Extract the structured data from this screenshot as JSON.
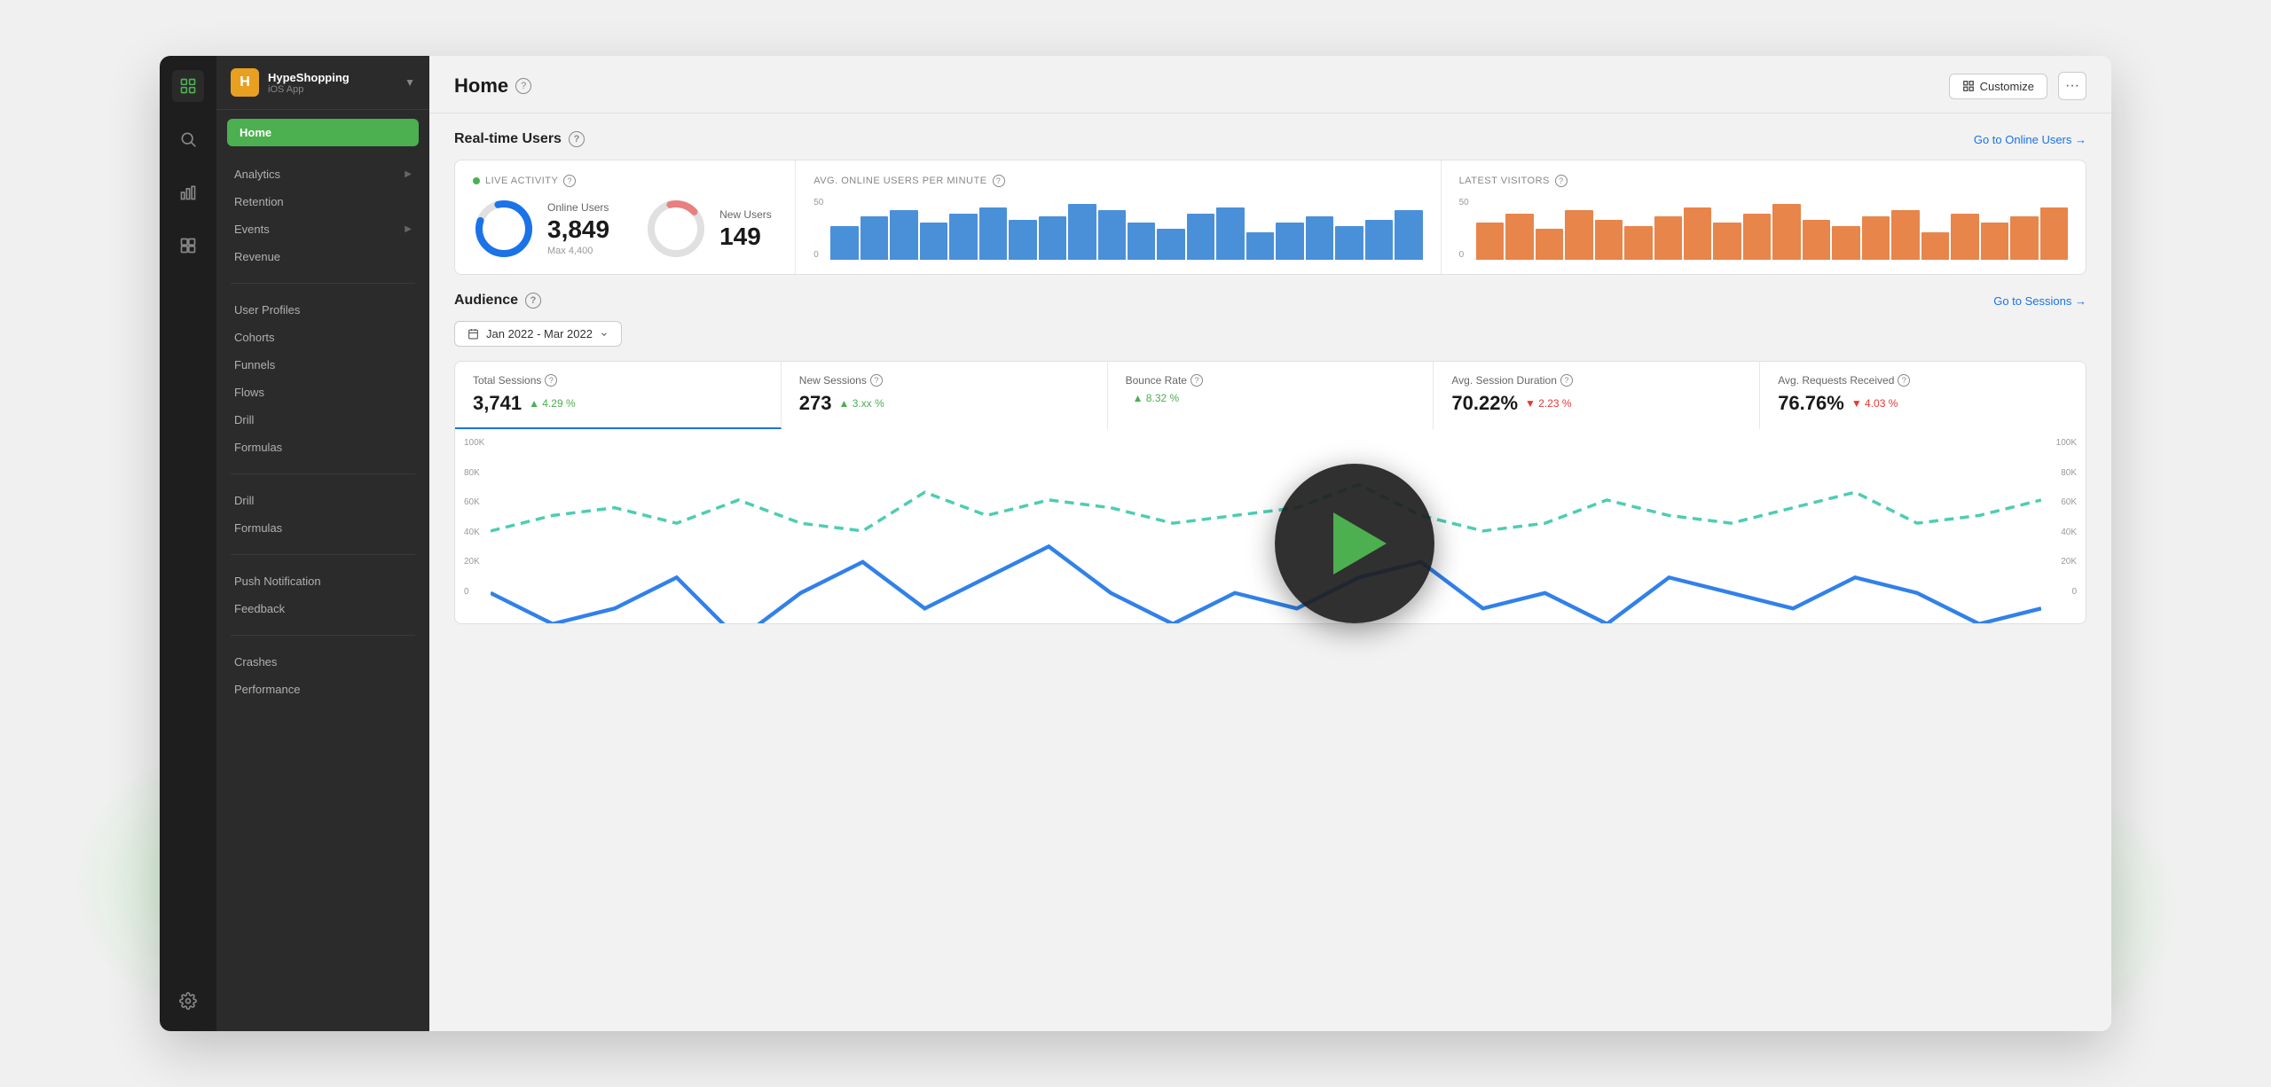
{
  "app": {
    "name": "HypeShopping",
    "type": "iOS App",
    "logo_letter": "H"
  },
  "nav": {
    "home_label": "Home",
    "analytics_label": "Analytics",
    "retention_label": "Retention",
    "events_label": "Events",
    "revenue_label": "Revenue",
    "user_profiles_label": "User Profiles",
    "cohorts_label": "Cohorts",
    "funnels_label": "Funnels",
    "flows_label": "Flows",
    "drill_label": "Drill",
    "formulas_label": "Formulas",
    "drill2_label": "Drill",
    "formulas2_label": "Formulas",
    "push_notification_label": "Push Notification",
    "feedback_label": "Feedback",
    "crashes_label": "Crashes",
    "performance_label": "Performance"
  },
  "page": {
    "title": "Home",
    "customize_label": "Customize",
    "more_label": "···"
  },
  "realtime": {
    "section_title": "Real-time Users",
    "goto_label": "Go to Online Users →",
    "live_activity_label": "LIVE ACTIVITY",
    "online_users_label": "Online Users",
    "online_users_count": "3,849",
    "online_users_max": "Max 4,400",
    "new_users_label": "New Users",
    "new_users_count": "149",
    "avg_label": "Avg. Online Users per Minute",
    "latest_visitors_label": "Latest Visitors",
    "y_high": "50",
    "y_low": "0",
    "y_high_right": "50",
    "y_low_right": "0"
  },
  "audience": {
    "section_title": "Audience",
    "date_range": "Jan 2022 - Mar 2022",
    "goto_label": "Go to Sessions →",
    "total_sessions_label": "Total Sessions",
    "total_sessions_value": "3,741",
    "total_sessions_change": "▲ 4.29 %",
    "total_sessions_direction": "up",
    "new_sessions_label": "New Sessions",
    "new_sessions_value": "273",
    "new_sessions_change": "▲ 3.xx %",
    "new_sessions_direction": "up",
    "bounce_rate_label": "Bounce Rate",
    "bounce_rate_value": "",
    "bounce_rate_change": "▲ 8.32 %",
    "bounce_rate_direction": "up",
    "avg_session_label": "Avg. Session Duration",
    "avg_session_value": "70.22%",
    "avg_session_change": "▼ 2.23 %",
    "avg_session_direction": "down",
    "avg_requests_label": "Avg. Requests Received",
    "avg_requests_value": "76.76%",
    "avg_requests_change": "▼ 4.03 %",
    "avg_requests_direction": "down",
    "chart_y_labels": [
      "100K",
      "80K",
      "60K",
      "40K",
      "20K",
      "0"
    ],
    "chart_y_labels_right": [
      "100K",
      "80K",
      "60K",
      "40K",
      "20K",
      "0"
    ]
  }
}
